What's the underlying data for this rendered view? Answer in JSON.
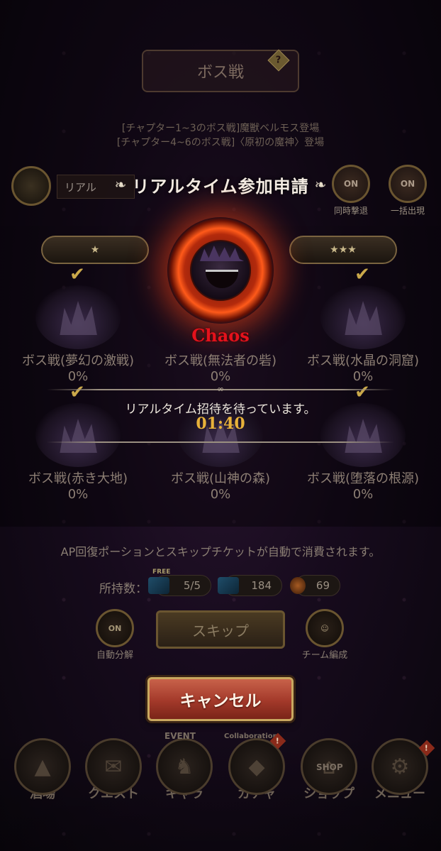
{
  "header": {
    "title": "ボス戦",
    "help_badge": "?",
    "chapter_lines": [
      "[チャプター1~3のボス戦]魔獣ベルモス登場",
      "[チャプター4~6のボス戦]〈原初の魔神〉登場"
    ],
    "left_switch_label": "リアル",
    "simultaneous_retreat": {
      "state": "ON",
      "label": "同時撃退"
    },
    "bulk_appear": {
      "state": "ON",
      "label": "一括出現"
    }
  },
  "popup": {
    "title": "リアルタイム参加申請",
    "boss_name": "Chaos",
    "waiting_text": "リアルタイム招待を待っています。",
    "timer": "01:40"
  },
  "difficulty": [
    {
      "stars": "★"
    },
    {
      "stars": "★★★"
    }
  ],
  "stages": [
    {
      "name": "ボス戦(夢幻の激戦)",
      "percent": "0%"
    },
    {
      "name": "ボス戦(無法者の砦)",
      "percent": "0%"
    },
    {
      "name": "ボス戦(水晶の洞窟)",
      "percent": "0%"
    },
    {
      "name": "ボス戦(赤き大地)",
      "percent": "0%"
    },
    {
      "name": "ボス戦(山神の森)",
      "percent": "0%"
    },
    {
      "name": "ボス戦(堕落の根源)",
      "percent": "0%"
    }
  ],
  "notice": "AP回復ポーションとスキップチケットが自動で消費されます。",
  "owned": {
    "label": "所持数：",
    "free_tag": "FREE",
    "free_tickets": "5/5",
    "tickets": "184",
    "potions": "69"
  },
  "controls": {
    "auto_disassemble": {
      "state": "ON",
      "label": "自動分解"
    },
    "skip_label": "スキップ",
    "team_label": "チーム編成",
    "cancel_label": "キャンセル"
  },
  "nav": {
    "items": [
      {
        "label": "酒場",
        "icon": "tavern-icon"
      },
      {
        "label": "クエスト",
        "icon": "quest-scroll-icon"
      },
      {
        "label": "キャラ",
        "icon": "character-knight-icon",
        "tag": "EVENT"
      },
      {
        "label": "ガチャ",
        "icon": "gacha-crystal-icon",
        "tag": "Collaboration"
      },
      {
        "label": "ショップ",
        "icon": "shop-sign-icon",
        "tag": "SHOP"
      },
      {
        "label": "メニュー",
        "icon": "menu-gear-icon"
      }
    ],
    "alert_badge": "!"
  },
  "colors": {
    "accent_gold": "#e8b23a",
    "boss_red": "#e4121c",
    "cancel_button": "#a3392a"
  }
}
